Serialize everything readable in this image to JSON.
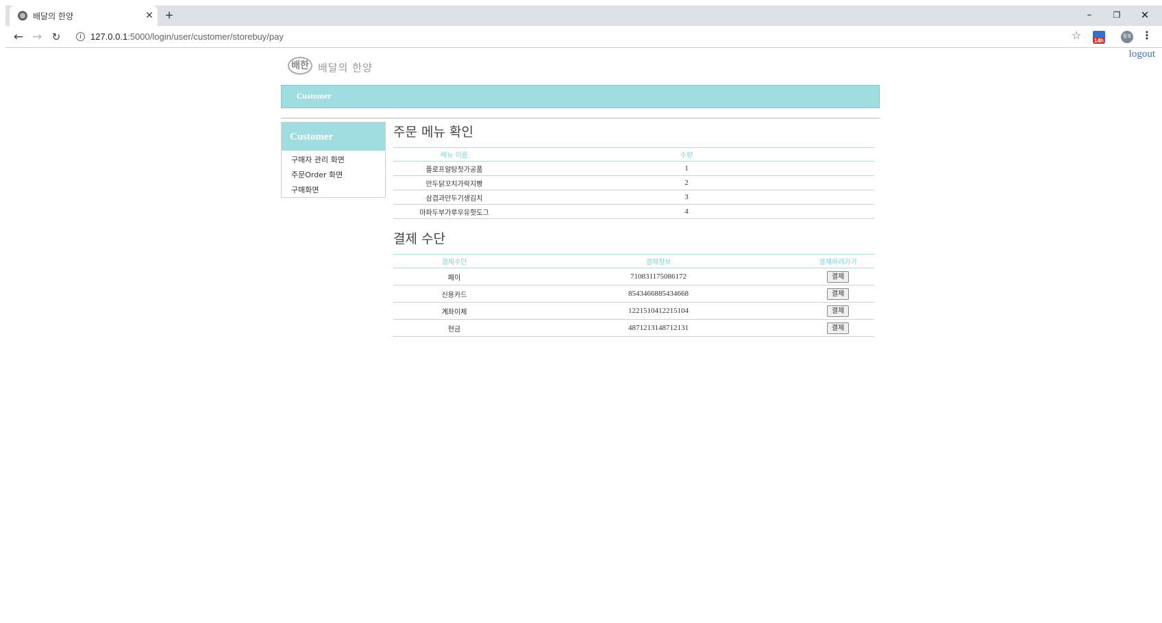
{
  "browser": {
    "tab_title": "배달의 한양",
    "tab_close": "✕",
    "new_tab": "+",
    "url_host": "127.0.0.1",
    "url_path": ":5000/login/user/customer/storebuy/pay",
    "ext_badge": "14h",
    "profile_label": "정호",
    "icons": {
      "back": "arrow-left",
      "forward": "arrow-right",
      "reload": "reload",
      "info": "info-circle",
      "bookmark": "star",
      "menu": "vertical-dots"
    },
    "window_controls": {
      "minimize": "–",
      "restore": "❐",
      "close": "✕"
    }
  },
  "page": {
    "logout_label": "logout",
    "logo_badge": "배한",
    "logo_text": "배달의 한양",
    "topnav_label": "Customer",
    "accent_color": "#a0dde1"
  },
  "sidebar": {
    "title": "Customer",
    "items": [
      {
        "label": "구매자 관리 화면"
      },
      {
        "label": "주문Order 화면"
      },
      {
        "label": "구매화면"
      }
    ]
  },
  "order": {
    "title": "주문 메뉴 확인",
    "columns": [
      "메뉴 이름",
      "수량",
      ""
    ],
    "rows": [
      {
        "name": "플로프알탕젓가공품",
        "qty": "1"
      },
      {
        "name": "만두닭꼬치가락지빵",
        "qty": "2"
      },
      {
        "name": "삼겹과만두기생김치",
        "qty": "3"
      },
      {
        "name": "마파두부가루우유핫도그",
        "qty": "4"
      }
    ]
  },
  "payment": {
    "title": "결제 수단",
    "columns": [
      "결제수단",
      "결제정보",
      "결제하러가기"
    ],
    "button_label": "결제",
    "rows": [
      {
        "method": "페이",
        "info": "710831175086172"
      },
      {
        "method": "신용카드",
        "info": "8543466885434668"
      },
      {
        "method": "계좌이체",
        "info": "1221510412215104"
      },
      {
        "method": "현금",
        "info": "4871213148712131"
      }
    ]
  }
}
